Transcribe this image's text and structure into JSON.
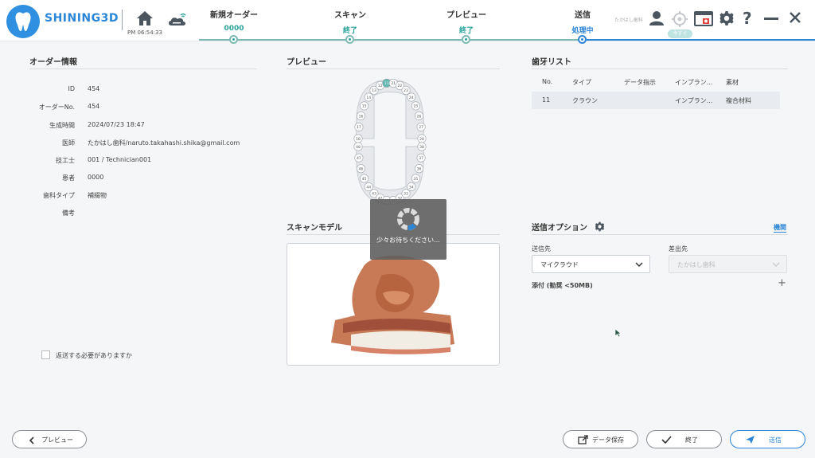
{
  "header": {
    "brand": "SHINING3D",
    "clock": "PM 06:54:33",
    "user_name": "たかはし歯科",
    "pill_text": "今すぐ",
    "steps": [
      {
        "label": "新規オーダー",
        "value": "0000"
      },
      {
        "label": "スキャン",
        "value": "終了"
      },
      {
        "label": "プレビュー",
        "value": "終了"
      },
      {
        "label": "送信",
        "value": "処理中"
      }
    ],
    "accent": "#2b86d8",
    "done_color": "#2aa39b"
  },
  "order": {
    "title": "オーダー情報",
    "fields": [
      {
        "label": "ID",
        "value": "454"
      },
      {
        "label": "オーダーNo.",
        "value": "454"
      },
      {
        "label": "生成時間",
        "value": "2024/07/23 18:47"
      },
      {
        "label": "医師",
        "value": "たかはし歯科/naruto.takahashi.shika@gmail.com"
      },
      {
        "label": "技工士",
        "value": "001 / Technician001"
      },
      {
        "label": "患者",
        "value": "0000"
      },
      {
        "label": "歯科タイプ",
        "value": "補綴物"
      },
      {
        "label": "備考",
        "value": ""
      }
    ],
    "return_label": "返送する必要がありますか"
  },
  "preview": {
    "title": "プレビュー",
    "upper_teeth": [
      "18",
      "17",
      "16",
      "15",
      "14",
      "13",
      "12",
      "11",
      "21",
      "22",
      "23",
      "24",
      "25",
      "26",
      "27",
      "28"
    ],
    "lower_teeth": [
      "48",
      "47",
      "46",
      "45",
      "44",
      "43",
      "42",
      "41",
      "31",
      "32",
      "33",
      "34",
      "35",
      "36",
      "37",
      "38"
    ],
    "selected_tooth": "11"
  },
  "scan": {
    "title": "スキャンモデル",
    "loading_text": "少々お待ちください..."
  },
  "teeth_list": {
    "title": "歯牙リスト",
    "columns": [
      "No.",
      "タイプ",
      "データ指示",
      "インプラン...",
      "素材"
    ],
    "rows": [
      {
        "no": "11",
        "type": "クラウン",
        "data": "",
        "implant": "インプラン...",
        "material": "複合材料"
      }
    ]
  },
  "send": {
    "title": "送信オプション",
    "org_link": "機関",
    "dest_label": "送信先",
    "dest_value": "マイクラウド",
    "sender_label": "差出先",
    "sender_value": "たかはし歯科",
    "attach_label": "添付 (勧奨 <50MB)"
  },
  "footer": {
    "preview_btn": "プレビュー",
    "save_btn": "データ保存",
    "finish_btn": "終了",
    "send_btn": "送信"
  }
}
